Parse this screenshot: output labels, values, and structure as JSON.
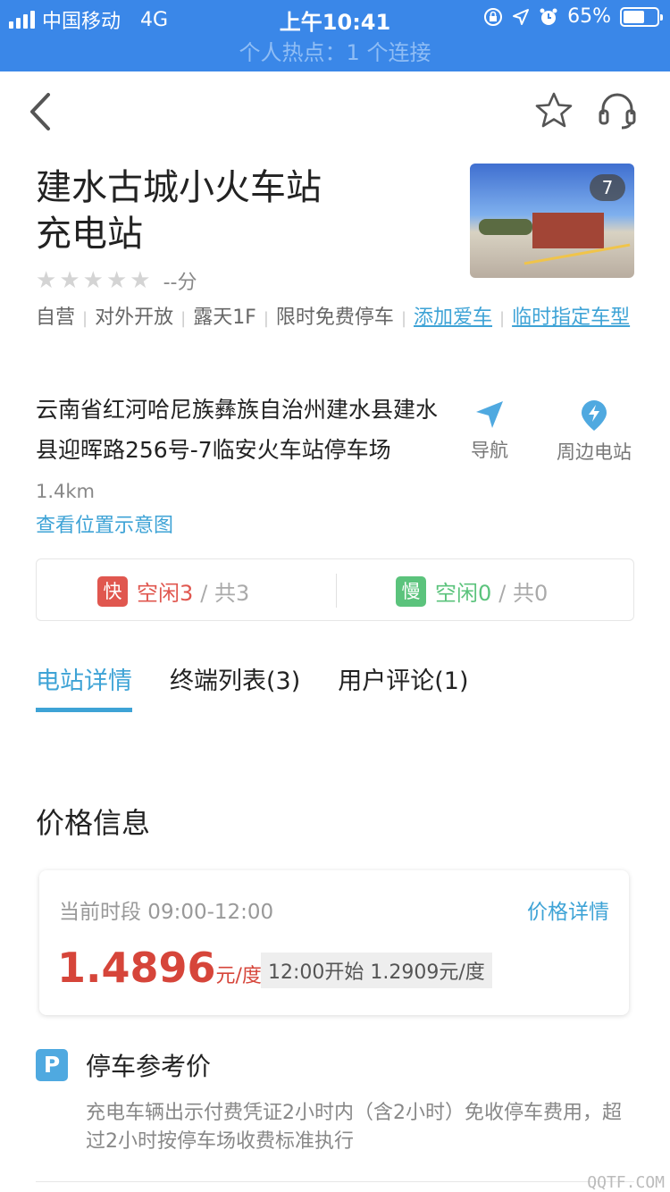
{
  "status_bar": {
    "carrier": "中国移动",
    "network": "4G",
    "time": "上午10:41",
    "battery_percent": "65%",
    "battery_level": 0.65,
    "hotspot": "个人热点：1 个连接"
  },
  "station": {
    "title_line1": "建水古城小火车站",
    "title_line2": "充电站",
    "photo_count": "7",
    "rating_stars": 0,
    "score": "--分",
    "tags": [
      "自营",
      "对外开放",
      "露天1F",
      "限时免费停车"
    ],
    "links": [
      "添加爱车",
      "临时指定车型"
    ],
    "address": "云南省红河哈尼族彝族自治州建水县建水县迎晖路256号-7临安火车站停车场",
    "distance": "1.4km",
    "map_link": "查看位置示意图",
    "navigate_label": "导航",
    "nearby_label": "周边电站"
  },
  "chargers": {
    "fast_badge": "快",
    "fast_free": "空闲3",
    "fast_total": "/ 共3",
    "slow_badge": "慢",
    "slow_free": "空闲0",
    "slow_total": "/ 共0"
  },
  "tabs": [
    {
      "label": "电站详情",
      "active": true
    },
    {
      "label": "终端列表(3)",
      "active": false
    },
    {
      "label": "用户评论(1)",
      "active": false
    }
  ],
  "price": {
    "section_title": "价格信息",
    "period": "当前时段 09:00-12:00",
    "detail_link": "价格详情",
    "value": "1.4896",
    "unit": "元/度",
    "next": "12:00开始 1.2909元/度"
  },
  "parking": {
    "icon_letter": "P",
    "title": "停车参考价",
    "description": "充电车辆出示付费凭证2小时内（含2小时）免收停车费用，超过2小时按停车场收费标准执行"
  },
  "watermark": "QQTF.COM",
  "colors": {
    "status_bar": "#3a87e8",
    "accent": "#3ea3d6",
    "fast": "#e0574f",
    "slow": "#5bc37c",
    "price": "#d6453a"
  }
}
